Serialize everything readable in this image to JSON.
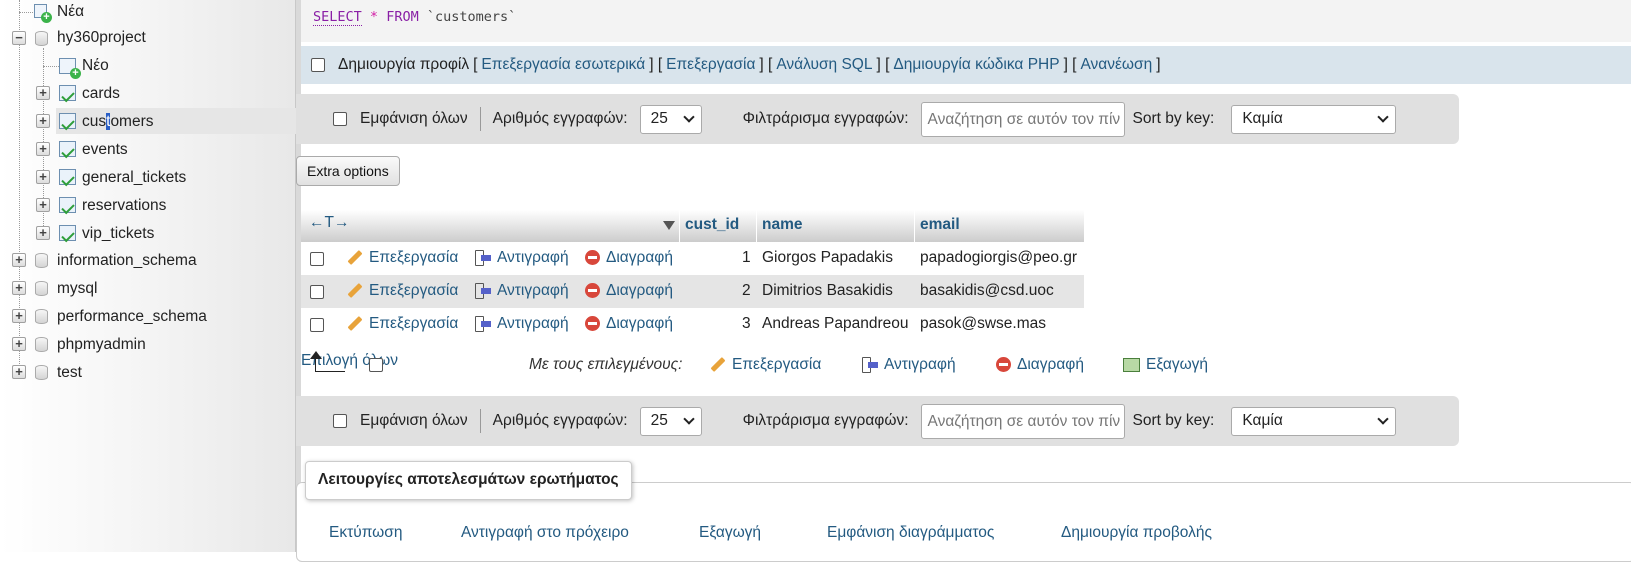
{
  "sidebar": {
    "new_top": "Νέα",
    "databases": [
      {
        "name": "hy360project",
        "expanded": true
      },
      {
        "name": "information_schema"
      },
      {
        "name": "mysql"
      },
      {
        "name": "performance_schema"
      },
      {
        "name": "phpmyadmin"
      },
      {
        "name": "test"
      }
    ],
    "new_table": "Νέο",
    "tables": [
      "cards",
      "customers",
      "events",
      "general_tickets",
      "reservations",
      "vip_tickets"
    ],
    "customers_parts": [
      "cus",
      "t",
      "omers"
    ]
  },
  "sql": {
    "select": "SELECT",
    "star": "*",
    "from": "FROM",
    "table": "`customers`"
  },
  "actions": {
    "profile": "Δημιουργία προφίλ",
    "links": [
      "Επεξεργασία εσωτερικά",
      "Επεξεργασία",
      "Ανάλυση SQL",
      "Δημιουργία κώδικα PHP",
      "Ανανέωση"
    ]
  },
  "nav": {
    "show_all": "Εμφάνιση όλων",
    "rows_label": "Αριθμός εγγραφών:",
    "rows_value": "25",
    "filter_label": "Φιλτράρισμα εγγραφών:",
    "filter_placeholder": "Αναζήτηση σε αυτόν τον πίν",
    "sort_label": "Sort by key:",
    "sort_value": "Καμία"
  },
  "extra_options": "Extra options",
  "table": {
    "options_icon": "←T→",
    "columns": [
      "cust_id",
      "name",
      "email"
    ],
    "row_actions": {
      "edit": "Επεξεργασία",
      "copy": "Αντιγραφή",
      "delete": "Διαγραφή"
    },
    "rows": [
      {
        "cust_id": "1",
        "name": "Giorgos Papadakis",
        "email": "papadogiorgis@peo.gr"
      },
      {
        "cust_id": "2",
        "name": "Dimitrios Basakidis",
        "email": "basakidis@csd.uoc"
      },
      {
        "cust_id": "3",
        "name": "Andreas Papandreou",
        "email": "pasok@swse.mas"
      }
    ]
  },
  "bulk": {
    "select_all": "Επιλογή όλων",
    "with_selected": "Με τους επιλεγμένους:",
    "edit": "Επεξεργασία",
    "copy": "Αντιγραφή",
    "delete": "Διαγραφή",
    "export": "Εξαγωγή"
  },
  "query_ops": {
    "legend": "Λειτουργίες αποτελεσμάτων ερωτήματος",
    "items": [
      "Εκτύπωση",
      "Αντιγραφή στο πρόχειρο",
      "Εξαγωγή",
      "Εμφάνιση διαγράμματος",
      "Δημιουργία προβολής"
    ]
  }
}
